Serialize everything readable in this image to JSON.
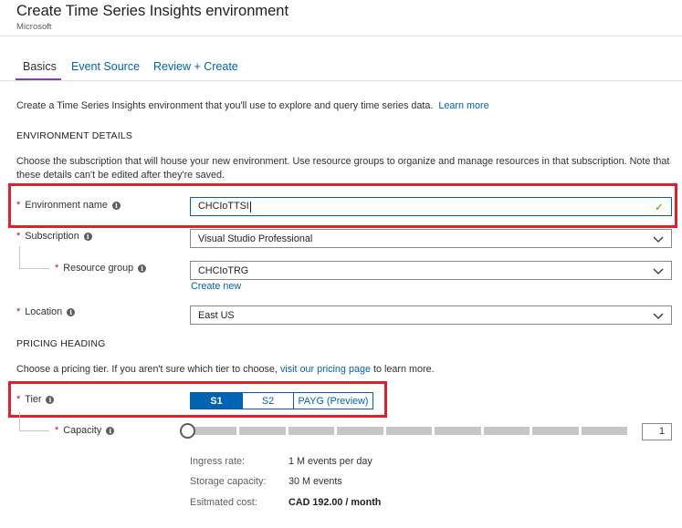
{
  "header": {
    "title": "Create Time Series Insights environment",
    "subtitle": "Microsoft"
  },
  "tabs": [
    {
      "label": "Basics",
      "active": true
    },
    {
      "label": "Event Source",
      "active": false
    },
    {
      "label": "Review + Create",
      "active": false
    }
  ],
  "intro": {
    "text": "Create a Time Series Insights environment that you'll use to explore and query time series data.",
    "link": "Learn more"
  },
  "environment_details": {
    "heading": "ENVIRONMENT DETAILS",
    "description": "Choose the subscription that will house your new environment. Use resource groups to organize and manage resources in that subscription. Note that these details can't be edited after they're saved."
  },
  "fields": {
    "environment_name": {
      "label": "Environment name",
      "value": "CHCIoTTSI"
    },
    "subscription": {
      "label": "Subscription",
      "value": "Visual Studio Professional"
    },
    "resource_group": {
      "label": "Resource group",
      "value": "CHCIoTRG",
      "create_new": "Create new"
    },
    "location": {
      "label": "Location",
      "value": "East US"
    }
  },
  "pricing": {
    "heading": "PRICING HEADING",
    "description_before": "Choose a pricing tier. If you aren't sure which tier to choose,",
    "description_link": "visit our pricing page",
    "description_after": "to learn more.",
    "tier_label": "Tier",
    "tiers": [
      "S1",
      "S2",
      "PAYG (Preview)"
    ],
    "selected_tier": "S1",
    "capacity_label": "Capacity",
    "capacity_value": "1",
    "capacity_min": 1,
    "capacity_max": 10
  },
  "details": [
    {
      "key": "Ingress rate:",
      "value": "1 M events per day"
    },
    {
      "key": "Storage capacity:",
      "value": "30 M events"
    },
    {
      "key": "Esitmated cost:",
      "value": "CAD 192.00 / month"
    }
  ],
  "colors": {
    "accent": "#0063b1",
    "tab_underline": "#8a3fa0",
    "required": "#c50f1f",
    "highlight": "#e0202e",
    "valid": "#57a300"
  }
}
